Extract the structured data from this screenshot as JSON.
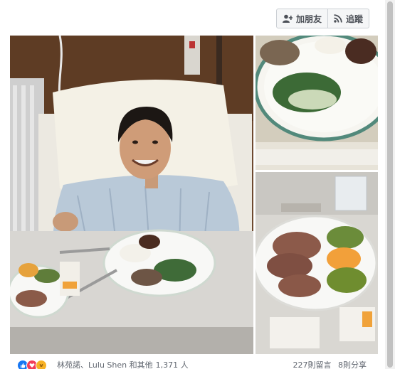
{
  "header": {
    "add_friend_label": "加朋友",
    "follow_label": "追蹤"
  },
  "footer": {
    "reactors": "林苑諾、Lulu Shen 和其他",
    "reaction_count": "1,371 人",
    "comments": "227則留言",
    "shares": "8則分享"
  },
  "icons": [
    "add-friend-icon",
    "rss-icon",
    "like-icon",
    "love-icon",
    "haha-icon"
  ],
  "colors": {
    "reaction_like": "#1877f2",
    "reaction_love": "#f33e58",
    "reaction_haha": "#f7b125"
  }
}
